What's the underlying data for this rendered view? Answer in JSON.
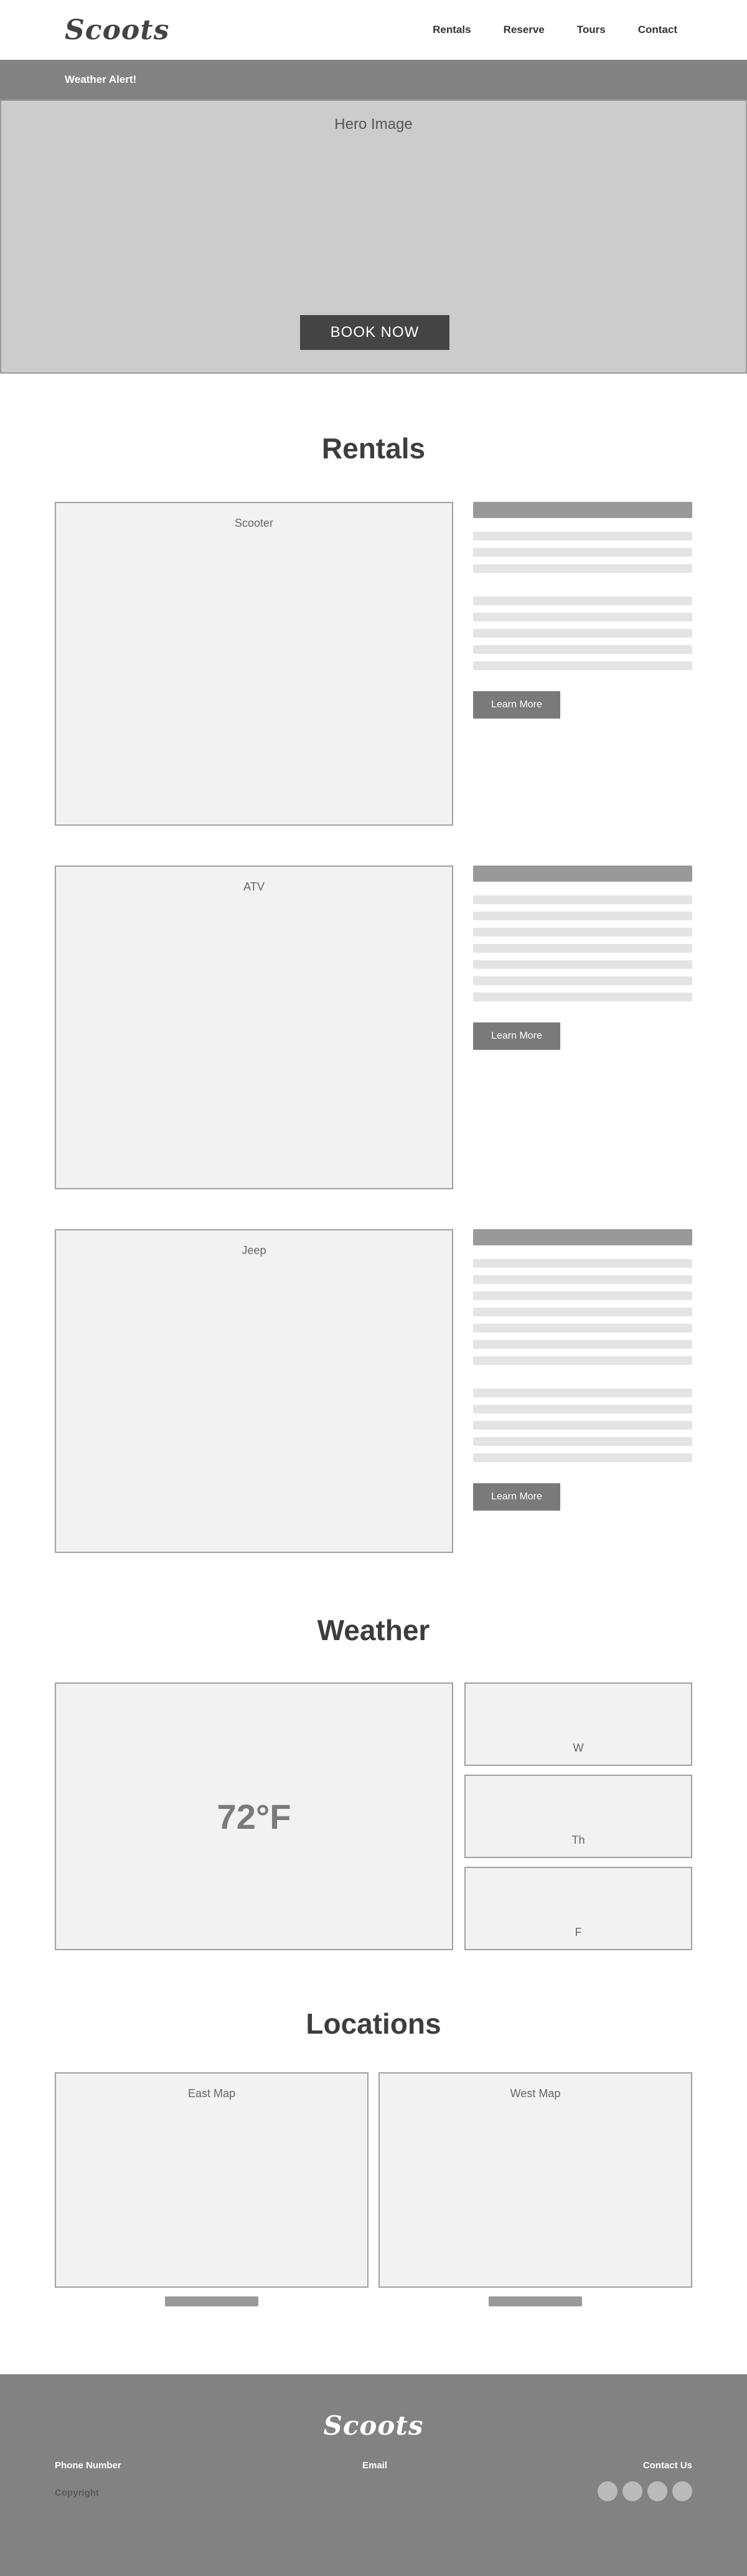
{
  "header": {
    "logo": "Scoots",
    "nav": [
      "Rentals",
      "Reserve",
      "Tours",
      "Contact"
    ]
  },
  "alert": {
    "text": "Weather Alert!"
  },
  "hero": {
    "label": "Hero Image",
    "button": "BOOK NOW"
  },
  "rentals": {
    "title": "Rentals",
    "items": [
      {
        "image_label": "Scooter",
        "button": "Learn More"
      },
      {
        "image_label": "ATV",
        "button": "Learn More"
      },
      {
        "image_label": "Jeep",
        "button": "Learn More"
      }
    ]
  },
  "weather": {
    "title": "Weather",
    "current": "72°F",
    "forecast": [
      "W",
      "Th",
      "F"
    ]
  },
  "locations": {
    "title": "Locations",
    "maps": [
      "East Map",
      "West Map"
    ]
  },
  "footer": {
    "logo": "Scoots",
    "phone": "Phone Number",
    "email": "Email",
    "contact": "Contact Us",
    "copyright": "Copyright"
  },
  "colors": {
    "alert_bar": "#828282",
    "hero_bg": "#cccccc",
    "book_button": "#444444",
    "learn_button": "#7a7a7a",
    "footer_bg": "#828282"
  }
}
